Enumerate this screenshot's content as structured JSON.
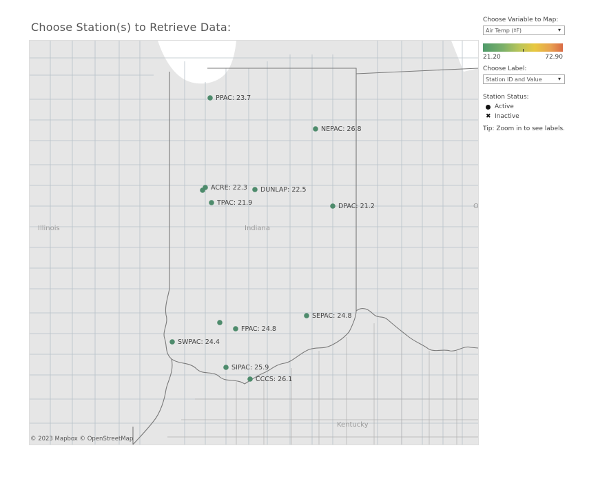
{
  "title": "Choose Station(s) to Retrieve Data:",
  "attribution": "© 2023 Mapbox © OpenStreetMap",
  "controls": {
    "variable_label": "Choose Variable to Map:",
    "variable_value": "Air Temp (ºF)",
    "label_label": "Choose Label:",
    "label_value": "Station ID and Value",
    "ramp_min": "21.20",
    "ramp_max": "72.90",
    "status_title": "Station Status:",
    "status_active": "Active",
    "status_inactive": "Inactive",
    "tip": "Tip: Zoom in to see labels."
  },
  "colors": {
    "station": "#4e8b6c",
    "map_bg": "#e6e6e6",
    "county_line": "#b7c1c9",
    "state_line": "#7a7a7a"
  },
  "map": {
    "regions": {
      "illinois": "Illinois",
      "indiana": "Indiana",
      "kentucky": "Kentucky",
      "ohio_partial": "O"
    },
    "stations": [
      {
        "id": "PPAC",
        "label": "PPAC: 23.7"
      },
      {
        "id": "NEPAC",
        "label": "NEPAC: 26.8"
      },
      {
        "id": "ACRE",
        "label": "ACRE: 22.3"
      },
      {
        "id": "DUNLAP",
        "label": "DUNLAP: 22.5"
      },
      {
        "id": "TPAC",
        "label": "TPAC: 21.9"
      },
      {
        "id": "DPAC",
        "label": "DPAC: 21.2"
      },
      {
        "id": "SEPAC",
        "label": "SEPAC: 24.8"
      },
      {
        "id": "FPAC",
        "label": "FPAC: 24.8"
      },
      {
        "id": "SWPAC",
        "label": "SWPAC: 24.4"
      },
      {
        "id": "SIPAC",
        "label": "SIPAC: 25.9"
      },
      {
        "id": "CCCS",
        "label": "CCCS: 26.1"
      }
    ]
  }
}
